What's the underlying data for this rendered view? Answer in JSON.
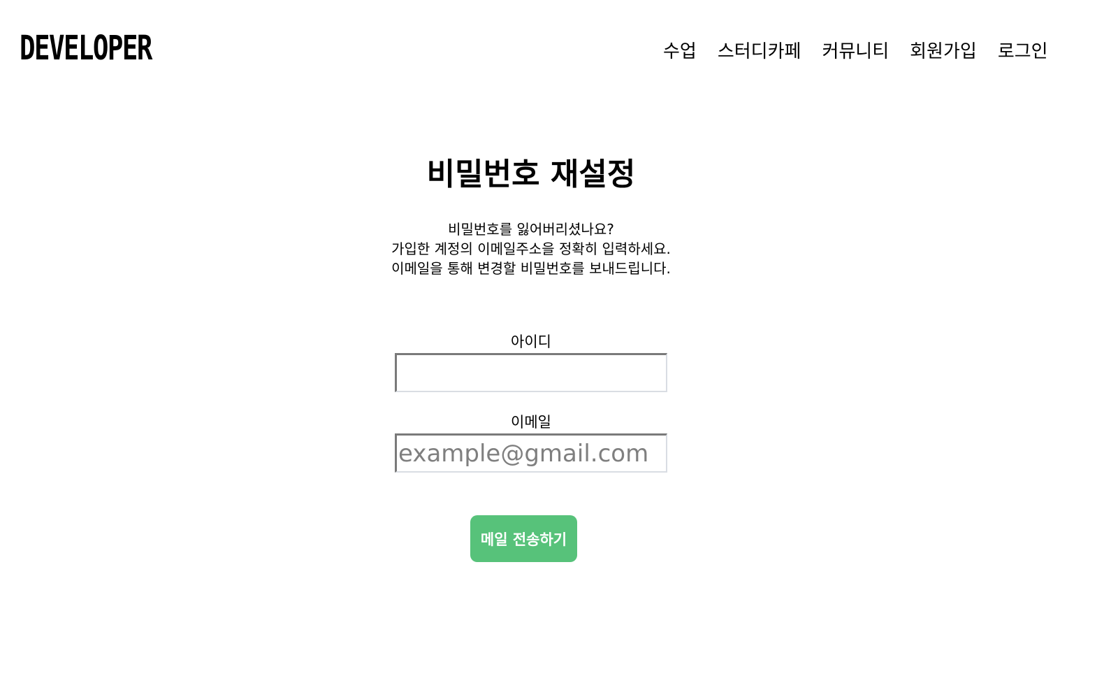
{
  "header": {
    "logo": "DEVELOPER",
    "nav": [
      {
        "label": "수업"
      },
      {
        "label": "스터디카페"
      },
      {
        "label": "커뮤니티"
      },
      {
        "label": "회원가입"
      },
      {
        "label": "로그인"
      }
    ]
  },
  "main": {
    "title": "비밀번호 재설정",
    "description": [
      "비밀번호를 잃어버리셨나요?",
      "가입한 계정의 이메일주소을 정확히 입력하세요.",
      "이메일을 통해 변경할 비밀번호를 보내드립니다."
    ],
    "fields": {
      "id": {
        "label": "아이디",
        "value": "",
        "placeholder": ""
      },
      "email": {
        "label": "이메일",
        "value": "",
        "placeholder": "example@gmail.com"
      }
    },
    "submit_label": "메일 전송하기"
  },
  "colors": {
    "accent": "#57c27a",
    "text": "#000000",
    "background": "#ffffff"
  }
}
